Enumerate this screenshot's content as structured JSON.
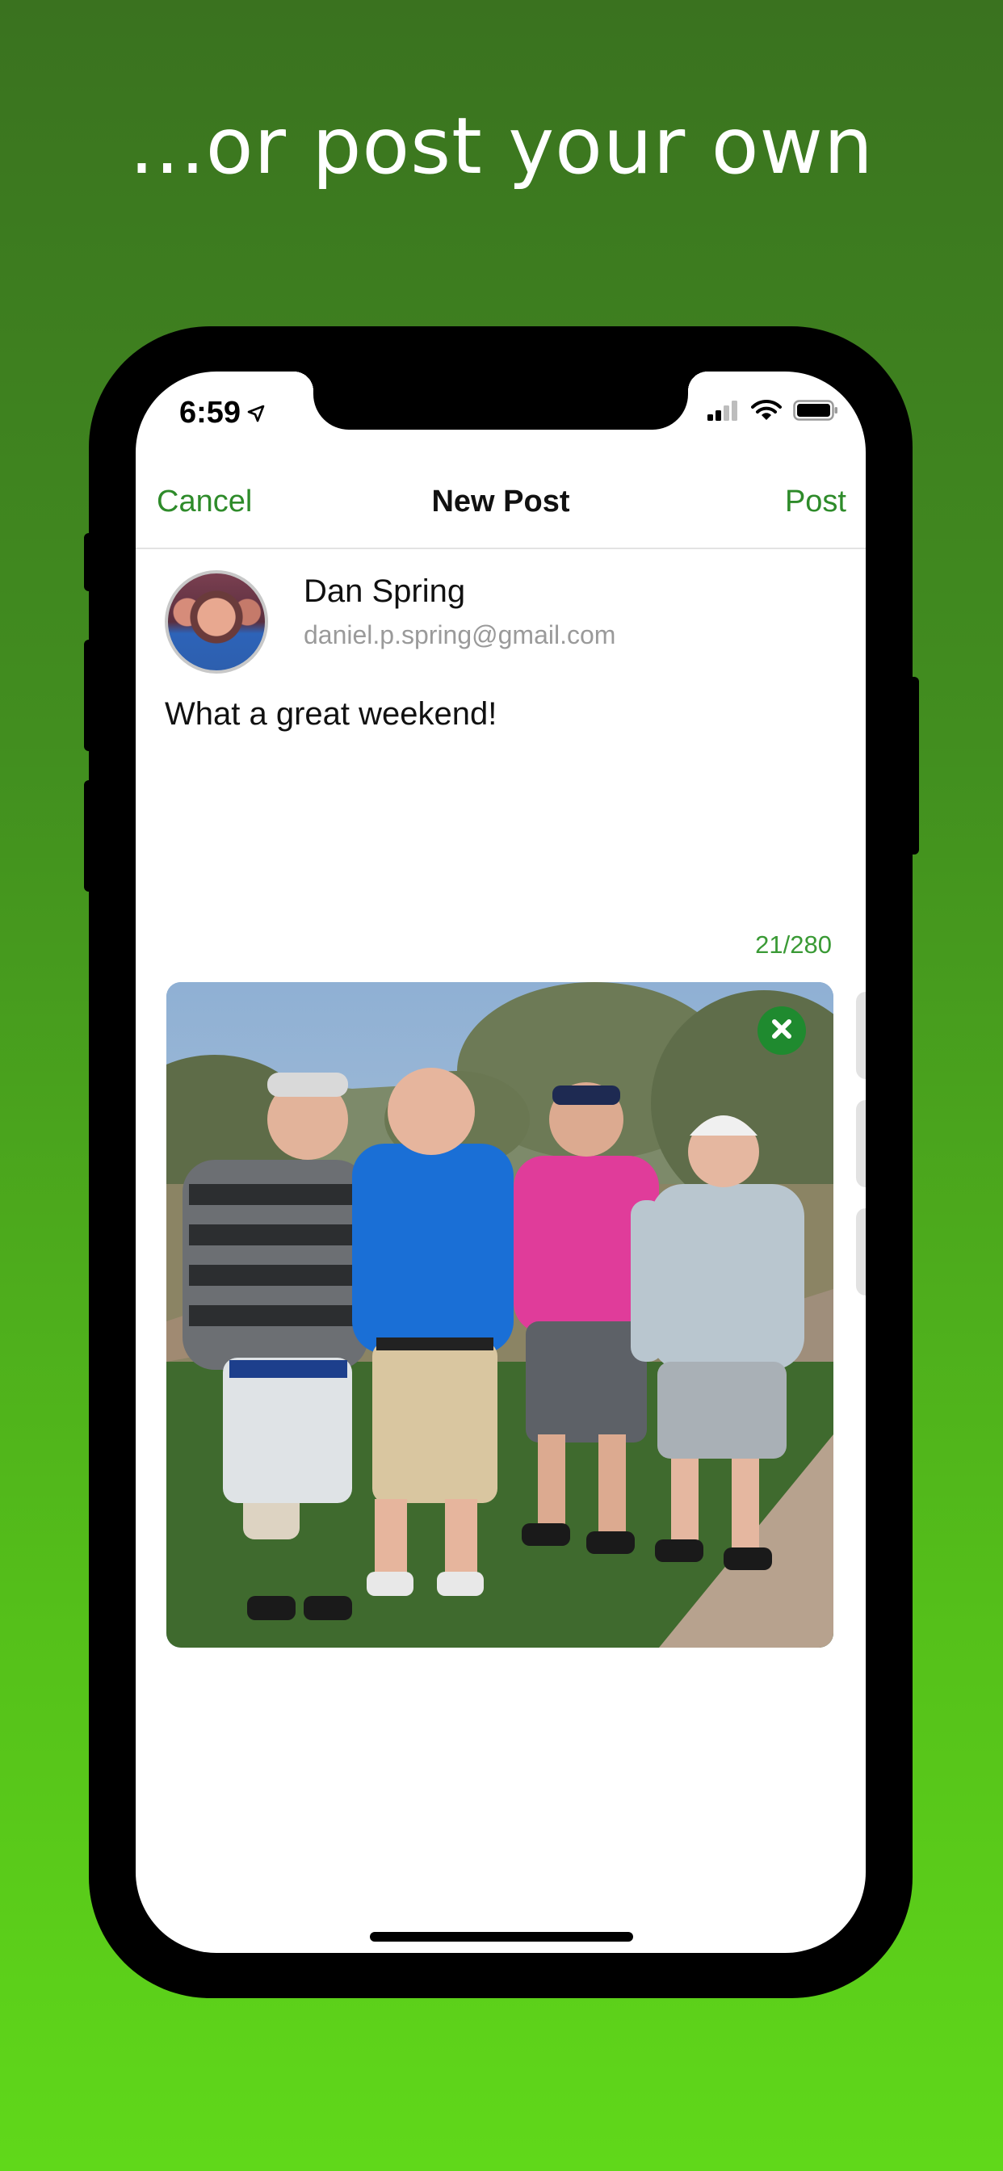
{
  "headline": "...or post your own",
  "status_bar": {
    "time": "6:59",
    "icons": [
      "location-arrow-icon",
      "cellular-signal-icon",
      "wifi-icon",
      "battery-icon"
    ]
  },
  "nav": {
    "cancel_label": "Cancel",
    "title": "New Post",
    "post_label": "Post"
  },
  "user": {
    "name": "Dan Spring",
    "email": "daniel.p.spring@gmail.com"
  },
  "post": {
    "text": "What a great weekend!",
    "char_count": "21/280"
  },
  "attachment": {
    "remove_icon": "close-circle-icon"
  },
  "colors": {
    "accent": "#2e8b2a",
    "counter": "#3a9a35",
    "background_top": "#3a721f",
    "background_bottom": "#60d81a"
  }
}
